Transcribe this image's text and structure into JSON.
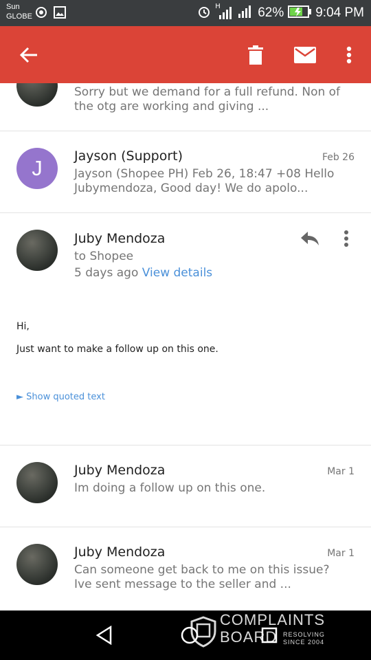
{
  "status_bar": {
    "carrier_line1": "Sun",
    "carrier_line2": "GLOBE",
    "network_type": "H",
    "battery": "62%",
    "time": "9:04 PM",
    "icons": [
      "location-icon",
      "image-notification-icon",
      "alarm-icon",
      "signal-icon",
      "signal-icon",
      "battery-charging-icon"
    ]
  },
  "app_bar": {
    "color": "#db4437",
    "icons": [
      "back-arrow-icon",
      "trash-icon",
      "mail-icon",
      "more-vert-icon"
    ]
  },
  "messages": [
    {
      "sender": "",
      "snippet": "Sorry but we demand for a full refund. Non of the otg are working and giving ...",
      "date": ""
    },
    {
      "sender": "Jayson (Support)",
      "avatar_letter": "J",
      "avatar_color": "#9575cd",
      "snippet": "Jayson (Shopee PH) Feb 26, 18:47 +08 Hello Jubymendoza, Good day! We do apolo...",
      "date": "Feb 26"
    }
  ],
  "expanded_message": {
    "sender": "Juby Mendoza",
    "recipient": "to Shopee",
    "time_ago": "5 days ago",
    "view_details": "View details",
    "greeting": "Hi,",
    "body": "Just want to make a follow up on this one.",
    "show_quoted": "► Show quoted text"
  },
  "later_messages": [
    {
      "sender": "Juby Mendoza",
      "snippet": "Im doing a follow up on this one.",
      "date": "Mar 1"
    },
    {
      "sender": "Juby Mendoza",
      "snippet": "Can someone get back to me on this issue? Ive sent message to the seller and ...",
      "date": "Mar 1"
    }
  ],
  "watermark": {
    "line1": "COMPLAINTS",
    "line2": "BOARD",
    "tag1": "RESOLVING",
    "tag2": "SINCE 2004"
  }
}
